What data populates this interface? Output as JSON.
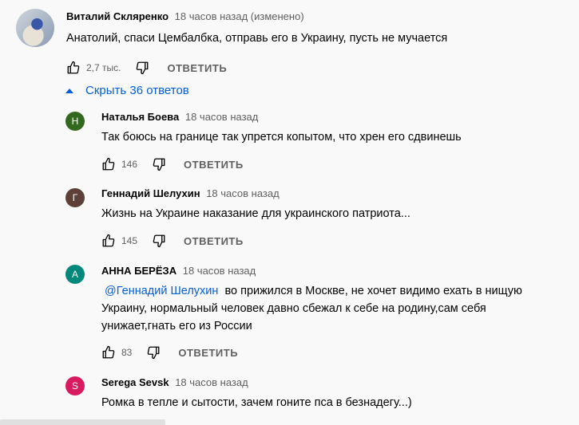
{
  "top_comment": {
    "author": "Виталий Скляренко",
    "time": "18 часов назад (изменено)",
    "text": "Анатолий, спаси Цембалбка, отправь его в Украину, пусть не мучается",
    "likes": "2,7 тыс.",
    "reply_label": "ОТВЕТИТЬ"
  },
  "hide_replies_label": "Скрыть 36 ответов",
  "replies": [
    {
      "initial": "Н",
      "avatar_color": "#33691e",
      "author": "Наталья Боева",
      "time": "18 часов назад",
      "text": "Так боюсь на границе так упрется копытом, что хрен  его  сдвинешь",
      "likes": "146",
      "reply_label": "ОТВЕТИТЬ"
    },
    {
      "initial": "Г",
      "avatar_color": "#5d4037",
      "author": "Геннадий Шелухин",
      "time": "18 часов назад",
      "text": "Жизнь на Украине наказание для украинского патриота...",
      "likes": "145",
      "reply_label": "ОТВЕТИТЬ"
    },
    {
      "initial": "А",
      "avatar_color": "#00897b",
      "author": "АННА БЕРЁЗА",
      "time": "18 часов назад",
      "mention": "@Геннадий Шелухин",
      "text": "  во прижился в Москве, не хочет видимо ехать в нищую Украину, нормальный человек давно сбежал к себе на родину,сам себя унижает,гнать его из России",
      "likes": "83",
      "reply_label": "ОТВЕТИТЬ"
    },
    {
      "initial": "S",
      "avatar_color": "#d81b60",
      "author": "Serega Sevsk",
      "time": "18 часов назад",
      "text": "Ромка в тепле и сытости, зачем гоните пса в безнадегу...)"
    }
  ]
}
